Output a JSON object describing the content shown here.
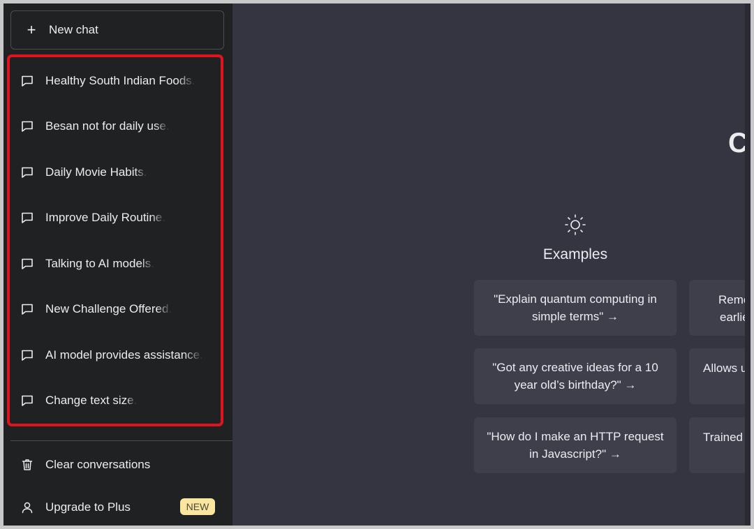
{
  "sidebar": {
    "new_chat_label": "New chat",
    "conversations": [
      {
        "label": "Healthy South Indian Foods."
      },
      {
        "label": "Besan not for daily use."
      },
      {
        "label": "Daily Movie Habits."
      },
      {
        "label": "Improve Daily Routine."
      },
      {
        "label": "Talking to AI models."
      },
      {
        "label": "New Challenge Offered."
      },
      {
        "label": "AI model provides assistance."
      },
      {
        "label": "Change text size."
      }
    ],
    "clear_label": "Clear conversations",
    "upgrade_label": "Upgrade to Plus",
    "upgrade_badge": "NEW"
  },
  "main": {
    "title_visible": "Cl",
    "examples_heading": "Examples",
    "examples": [
      {
        "text": "\"Explain quantum computing in simple terms\" →"
      },
      {
        "text": "\"Got any creative ideas for a 10 year old’s birthday?\" →"
      },
      {
        "text": "\"How do I make an HTTP request in Javascript?\" →"
      }
    ],
    "capabilities_partial": [
      {
        "line1": "Remem",
        "line2": "earlier"
      },
      {
        "line1": "Allows us",
        "line2": ""
      },
      {
        "line1": "Trained t",
        "line2": ""
      }
    ]
  },
  "colors": {
    "sidebar_bg": "#202123",
    "main_bg": "#343541",
    "card_bg": "#3e3f4b",
    "highlight_border": "#e0141e",
    "badge_bg": "#fae69e"
  }
}
